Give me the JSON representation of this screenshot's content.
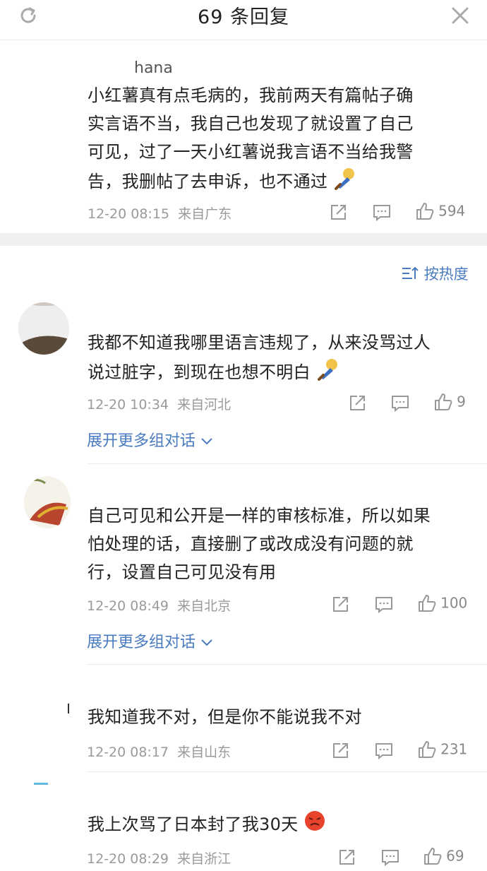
{
  "header": {
    "title": "69 条回复",
    "refresh_icon": "refresh-icon",
    "close_icon": "close-icon"
  },
  "top_comment": {
    "username": "hana",
    "text_lines": [
      "小红薯真有点毛病的，我前两天有篇帖子确",
      "实言语不当，我自己也发现了就设置了自己",
      "可见，过了一天小红薯说我言语不当给我警",
      "告，我删帖了去申诉，也不通过"
    ],
    "time": "12-20 08:15",
    "location": "来自广东",
    "likes": "594"
  },
  "sort": {
    "label": "按热度",
    "icon": "sort-icon"
  },
  "replies": [
    {
      "text_lines": [
        "我都不知道我哪里语言违规了，从来没骂过人",
        "说过脏字，到现在也想不明白"
      ],
      "time": "12-20 10:34",
      "location": "来自河北",
      "likes": "9",
      "expand": "展开更多组对话"
    },
    {
      "text_lines": [
        "自己可见和公开是一样的审核标准，所以如果",
        "怕处理的话，直接删了或改成没有问题的就",
        "行，设置自己可见没有用"
      ],
      "time": "12-20 08:49",
      "location": "来自北京",
      "likes": "100",
      "expand": "展开更多组对话"
    },
    {
      "text_lines": [
        "我知道我不对，但是你不能说我不对"
      ],
      "time": "12-20 08:17",
      "location": "来自山东",
      "likes": "231"
    },
    {
      "text_lines": [
        "我上次骂了日本封了我30天"
      ],
      "time": "12-20 08:29",
      "location": "来自浙江",
      "likes": "69"
    }
  ],
  "colors": {
    "link_blue": "#4a7bc0",
    "meta_gray": "#9a9a9a",
    "band_gray": "#f0f0f0"
  }
}
